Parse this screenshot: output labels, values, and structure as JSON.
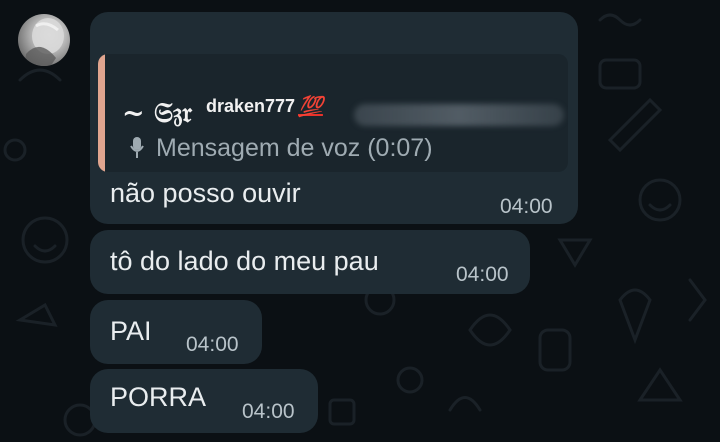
{
  "chat": {
    "quoted": {
      "sender_display": "~ 𝔖𝔷𝔯",
      "sender_handle": "draken777",
      "sender_emoji": "💯",
      "preview": "Mensagem de voz (0:07)"
    },
    "messages": [
      {
        "text": "não posso ouvir",
        "time": "04:00"
      },
      {
        "text": "tô do lado do meu pau",
        "time": "04:00"
      },
      {
        "text": "PAI",
        "time": "04:00"
      },
      {
        "text": "PORRA",
        "time": "04:00"
      }
    ]
  },
  "icons": {
    "quote_preview": "microphone-icon",
    "avatar": "user-avatar"
  },
  "colors": {
    "bubble": "#1f2c34",
    "quote_accent": "#e0a58f",
    "background": "#0b1014"
  }
}
